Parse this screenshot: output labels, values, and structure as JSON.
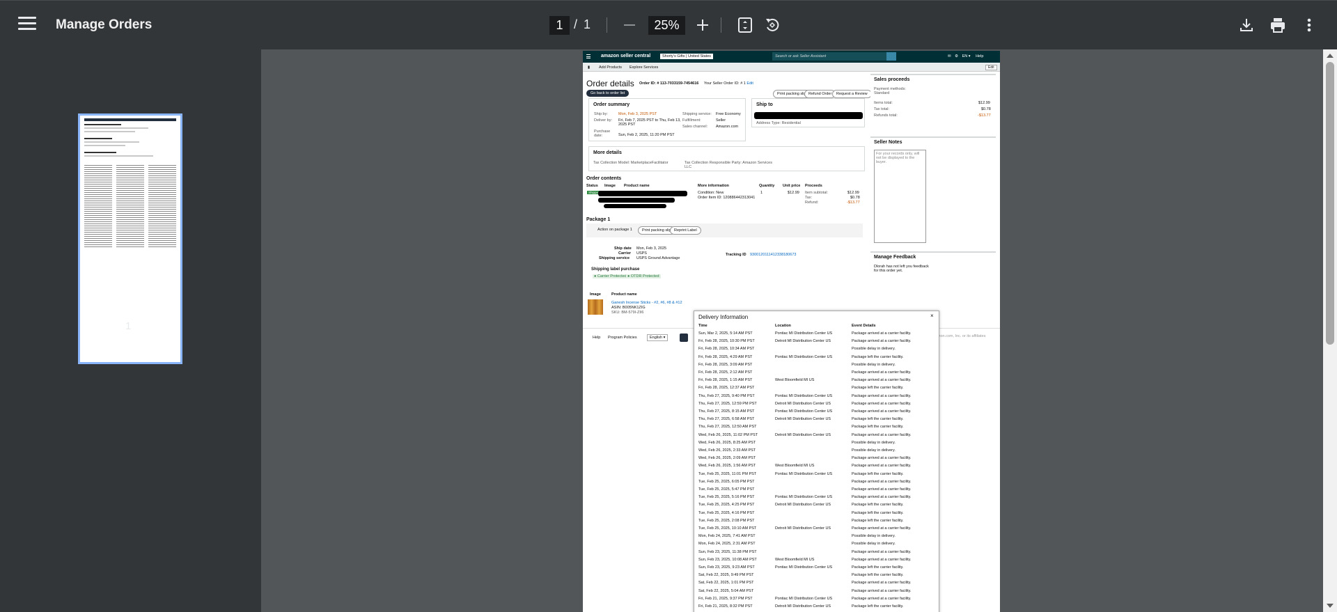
{
  "viewer": {
    "title": "Manage Orders",
    "current_page": "1",
    "page_sep": "/",
    "total_pages": "1",
    "zoom": "25%",
    "thumbnail_label": "1"
  },
  "sc": {
    "logo": "amazon seller central",
    "store": "Shorty's Gifts | United States",
    "search_placeholder": "Search or ask Seller Assistant",
    "lang": "EN ▾",
    "help": "Help",
    "nav_add": "Add Products",
    "nav_explore": "Explore Services",
    "edit": "Edit"
  },
  "order": {
    "title": "Order details",
    "order_id_label": "Order ID: # 113-7033159-7454616",
    "seller_order_id": "Your Seller Order ID: # 1",
    "edit": "Edit",
    "back_btn": "Go back to order list",
    "print_slip": "Print packing slip",
    "refund": "Refund Order",
    "review": "Request a Review"
  },
  "summary": {
    "title": "Order summary",
    "ship_by_label": "Ship by:",
    "ship_by": "Mon, Feb 3, 2025 PST",
    "deliver_by_label": "Deliver by:",
    "deliver_by": "Fri, Feb 7, 2025 PST to Thu, Feb 13, 2025 PST",
    "purchase_label": "Purchase date:",
    "purchase": "Sun, Feb 2, 2025, 11:20 PM PST",
    "shipping_service_label": "Shipping service:",
    "shipping_service": "Free Economy",
    "fulfillment_label": "Fulfillment:",
    "fulfillment": "Seller",
    "channel_label": "Sales channel:",
    "channel": "Amazon.com"
  },
  "ship_to": {
    "title": "Ship to",
    "address_type": "Address Type: Residential"
  },
  "more": {
    "title": "More details",
    "model": "Tax Collection Model: MarketplaceFacilitator",
    "party": "Tax Collection Responsible Party: Amazon Services LLC"
  },
  "contents": {
    "title": "Order contents",
    "headers": [
      "Status",
      "Image",
      "Product name",
      "More information",
      "Quantity",
      "Unit price",
      "Proceeds"
    ],
    "status": "Shipped",
    "condition": "Condition: New",
    "item_id": "Order Item ID: 120886442313041",
    "qty": "1",
    "unit_price": "$12.99",
    "subtotal_label": "Item subtotal:",
    "subtotal": "$12.99",
    "tax_label": "Tax:",
    "tax": "$0.78",
    "refund_label": "Refund:",
    "refund": "-$13.77"
  },
  "package": {
    "title": "Package 1",
    "action": "Action on package 1",
    "print_slip": "Print packing slip",
    "reprint": "Reprint Label",
    "ship_date_label": "Ship date",
    "ship_date": "Mon, Feb 3, 2025",
    "carrier_label": "Carrier",
    "carrier": "USPS",
    "service_label": "Shipping service",
    "service": "USPS Ground Advantage",
    "tracking_label": "Tracking ID",
    "tracking": "9300120111412338180673",
    "label_purchase": "Shipping label purchase",
    "carrier_protected": "Carrier Protected",
    "otdr": "OTDR Protected",
    "img_hdr": "Image",
    "product_hdr": "Product name",
    "product": "Ganesh Incense Sticks - #2, #6, #8 & #12",
    "asin": "ASIN: B005NK1ZIG",
    "sku": "SKU: BM-579I-ZII6"
  },
  "right": {
    "proceeds_title": "Sales proceeds",
    "payment": "Payment methods: Standard",
    "items_total_label": "Items total:",
    "items_total": "$12.99",
    "tax_total_label": "Tax total:",
    "tax_total": "$0.78",
    "refunds_total_label": "Refunds total:",
    "refunds_total": "-$13.77",
    "notes_title": "Seller Notes",
    "notes_placeholder": "For your records only, will not be displayed to the buyer.",
    "feedback_title": "Manage Feedback",
    "feedback_text": "Dlorah has not left you feedback for this order yet."
  },
  "footer": {
    "help": "Help",
    "policies": "Program Policies",
    "language": "English",
    "copyright": "amazon.com, Inc. or its affiliates"
  },
  "delivery": {
    "title": "Delivery Information",
    "close": "×",
    "headers": [
      "Time",
      "Location",
      "Event Details"
    ],
    "rows": [
      [
        "Sun, Mar 2, 2025, 5:14 AM PST",
        "Pontiac MI Distribution Center US",
        "Package arrived at a carrier facility."
      ],
      [
        "Fri, Feb 28, 2025, 10:30 PM PST",
        "Detroit MI Distribution Center US",
        "Package arrived at a carrier facility."
      ],
      [
        "Fri, Feb 28, 2025, 10:34 AM PST",
        "",
        "Possible delay in delivery."
      ],
      [
        "Fri, Feb 28, 2025, 4:29 AM PST",
        "Pontiac MI Distribution Center US",
        "Package left the carrier facility."
      ],
      [
        "Fri, Feb 28, 2025, 3:09 AM PST",
        "",
        "Possible delay in delivery."
      ],
      [
        "Fri, Feb 28, 2025, 2:12 AM PST",
        "",
        "Package arrived at a carrier facility."
      ],
      [
        "Fri, Feb 28, 2025, 1:15 AM PST",
        "West Bloomfield MI US",
        "Package arrived at a carrier facility."
      ],
      [
        "Fri, Feb 28, 2025, 12:37 AM PST",
        "",
        "Package left the carrier facility."
      ],
      [
        "Thu, Feb 27, 2025, 9:40 PM PST",
        "Pontiac MI Distribution Center US",
        "Package arrived at a carrier facility."
      ],
      [
        "Thu, Feb 27, 2025, 12:59 PM PST",
        "Detroit MI Distribution Center US",
        "Package arrived at a carrier facility."
      ],
      [
        "Thu, Feb 27, 2025, 8:15 AM PST",
        "Pontiac MI Distribution Center US",
        "Package arrived at a carrier facility."
      ],
      [
        "Thu, Feb 27, 2025, 6:58 AM PST",
        "Detroit MI Distribution Center US",
        "Package left the carrier facility."
      ],
      [
        "Thu, Feb 27, 2025, 12:50 AM PST",
        "",
        "Package left the carrier facility."
      ],
      [
        "Wed, Feb 26, 2025, 11:02 PM PST",
        "Detroit MI Distribution Center US",
        "Package arrived at a carrier facility."
      ],
      [
        "Wed, Feb 26, 2025, 8:25 AM PST",
        "",
        "Possible delay in delivery."
      ],
      [
        "Wed, Feb 26, 2025, 2:33 AM PST",
        "",
        "Possible delay in delivery."
      ],
      [
        "Wed, Feb 26, 2025, 2:09 AM PST",
        "",
        "Package arrived at a carrier facility."
      ],
      [
        "Wed, Feb 26, 2025, 1:56 AM PST",
        "West Bloomfield MI US",
        "Package arrived at a carrier facility."
      ],
      [
        "Tue, Feb 25, 2025, 11:01 PM PST",
        "Pontiac MI Distribution Center US",
        "Package left the carrier facility."
      ],
      [
        "Tue, Feb 25, 2025, 6:05 PM PST",
        "",
        "Package arrived at a carrier facility."
      ],
      [
        "Tue, Feb 25, 2025, 5:47 PM PST",
        "",
        "Package arrived at a carrier facility."
      ],
      [
        "Tue, Feb 25, 2025, 5:16 PM PST",
        "Pontiac MI Distribution Center US",
        "Package arrived at a carrier facility."
      ],
      [
        "Tue, Feb 25, 2025, 4:25 PM PST",
        "Detroit MI Distribution Center US",
        "Package left the carrier facility."
      ],
      [
        "Tue, Feb 25, 2025, 4:16 PM PST",
        "",
        "Package left the carrier facility."
      ],
      [
        "Tue, Feb 25, 2025, 2:08 PM PST",
        "",
        "Package left the carrier facility."
      ],
      [
        "Tue, Feb 25, 2025, 10:10 AM PST",
        "Detroit MI Distribution Center US",
        "Package arrived at a carrier facility."
      ],
      [
        "Mon, Feb 24, 2025, 7:41 AM PST",
        "",
        "Possible delay in delivery."
      ],
      [
        "Mon, Feb 24, 2025, 2:31 AM PST",
        "",
        "Possible delay in delivery."
      ],
      [
        "Sun, Feb 23, 2025, 11:38 PM PST",
        "",
        "Package arrived at a carrier facility."
      ],
      [
        "Sun, Feb 23, 2025, 10:08 AM PST",
        "West Bloomfield MI US",
        "Package arrived at a carrier facility."
      ],
      [
        "Sun, Feb 23, 2025, 9:23 AM PST",
        "Pontiac MI Distribution Center US",
        "Package left the carrier facility."
      ],
      [
        "Sat, Feb 22, 2025, 9:49 PM PST",
        "",
        "Package left the carrier facility."
      ],
      [
        "Sat, Feb 22, 2025, 1:01 PM PST",
        "",
        "Package arrived at a carrier facility."
      ],
      [
        "Sat, Feb 22, 2025, 5:04 AM PST",
        "",
        "Package arrived at a carrier facility."
      ],
      [
        "Fri, Feb 21, 2025, 9:37 PM PST",
        "Pontiac MI Distribution Center US",
        "Package arrived at a carrier facility."
      ],
      [
        "Fri, Feb 21, 2025, 8:32 PM PST",
        "Detroit MI Distribution Center US",
        "Package left the carrier facility."
      ]
    ]
  }
}
